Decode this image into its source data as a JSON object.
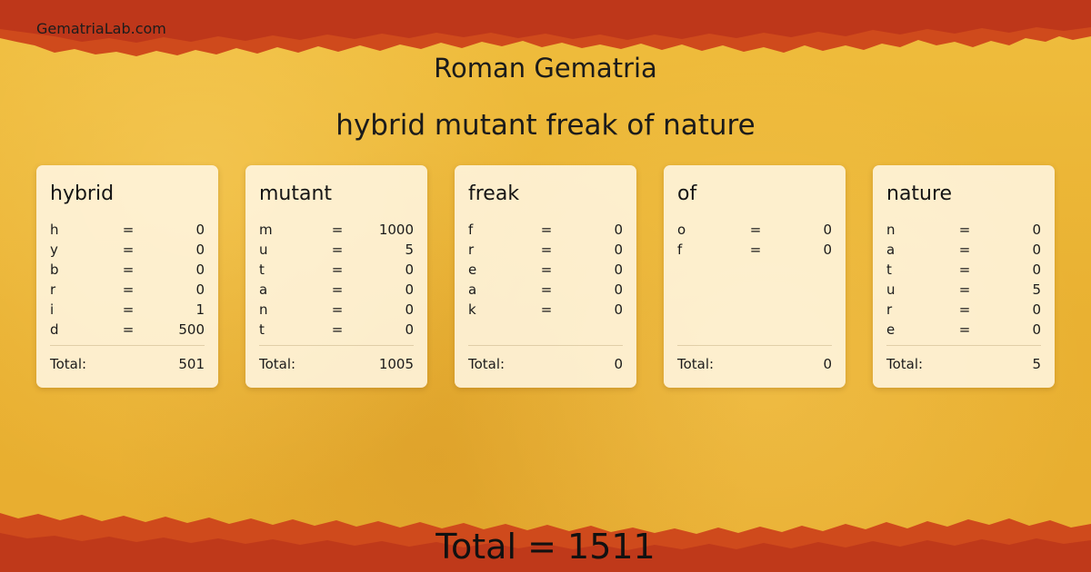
{
  "site": {
    "brand": "GematriaLab.com"
  },
  "header": {
    "cipher_title": "Roman Gematria",
    "phrase": "hybrid mutant freak of nature"
  },
  "cards": [
    {
      "word": "hybrid",
      "letters": [
        {
          "l": "h",
          "v": "0"
        },
        {
          "l": "y",
          "v": "0"
        },
        {
          "l": "b",
          "v": "0"
        },
        {
          "l": "r",
          "v": "0"
        },
        {
          "l": "i",
          "v": "1"
        },
        {
          "l": "d",
          "v": "500"
        }
      ],
      "total_label": "Total:",
      "total": "501"
    },
    {
      "word": "mutant",
      "letters": [
        {
          "l": "m",
          "v": "1000"
        },
        {
          "l": "u",
          "v": "5"
        },
        {
          "l": "t",
          "v": "0"
        },
        {
          "l": "a",
          "v": "0"
        },
        {
          "l": "n",
          "v": "0"
        },
        {
          "l": "t",
          "v": "0"
        }
      ],
      "total_label": "Total:",
      "total": "1005"
    },
    {
      "word": "freak",
      "letters": [
        {
          "l": "f",
          "v": "0"
        },
        {
          "l": "r",
          "v": "0"
        },
        {
          "l": "e",
          "v": "0"
        },
        {
          "l": "a",
          "v": "0"
        },
        {
          "l": "k",
          "v": "0"
        }
      ],
      "total_label": "Total:",
      "total": "0"
    },
    {
      "word": "of",
      "letters": [
        {
          "l": "o",
          "v": "0"
        },
        {
          "l": "f",
          "v": "0"
        }
      ],
      "total_label": "Total:",
      "total": "0"
    },
    {
      "word": "nature",
      "letters": [
        {
          "l": "n",
          "v": "0"
        },
        {
          "l": "a",
          "v": "0"
        },
        {
          "l": "t",
          "v": "0"
        },
        {
          "l": "u",
          "v": "5"
        },
        {
          "l": "r",
          "v": "0"
        },
        {
          "l": "e",
          "v": "0"
        }
      ],
      "total_label": "Total:",
      "total": "5"
    }
  ],
  "equals_sign": "=",
  "footer": {
    "grand_total": "Total = 1511"
  },
  "colors": {
    "band_dark": "#b8321a",
    "band_mid": "#cf4a1c",
    "paper": "#e9b132"
  }
}
